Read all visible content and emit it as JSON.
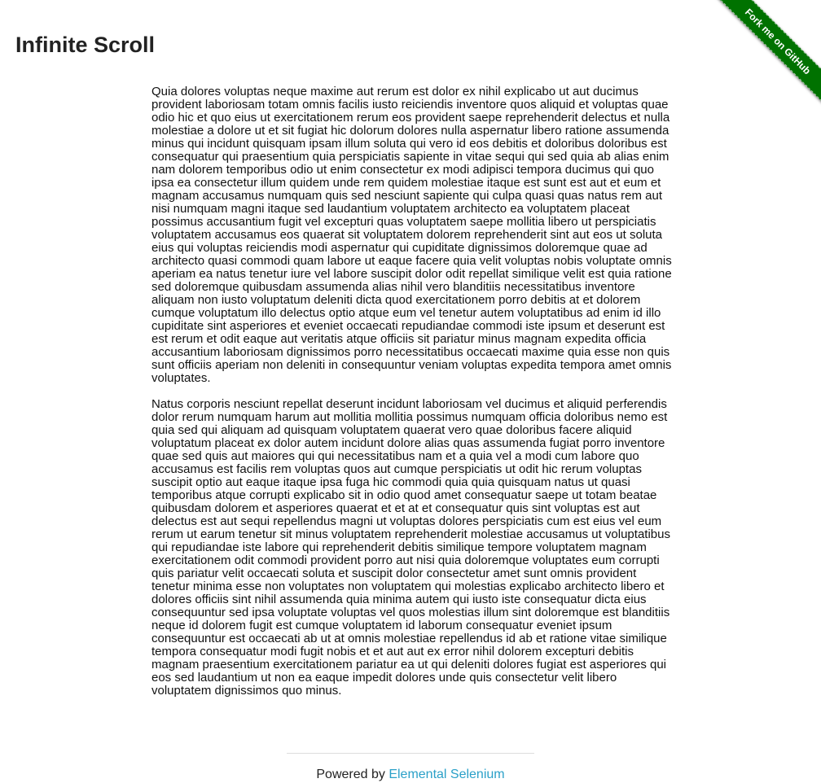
{
  "header": {
    "title": "Infinite Scroll"
  },
  "ribbon": {
    "label": "Fork me on GitHub",
    "color": "#007200"
  },
  "content": {
    "paragraphs": [
      "Quia dolores voluptas neque maxime aut rerum est dolor ex nihil explicabo ut aut ducimus provident laboriosam totam omnis facilis iusto reiciendis inventore quos aliquid et voluptas quae odio hic et quo eius ut exercitationem rerum eos provident saepe reprehenderit delectus et nulla molestiae a dolore ut et sit fugiat hic dolorum dolores nulla aspernatur libero ratione assumenda minus qui incidunt quisquam ipsam illum soluta qui vero id eos debitis et doloribus doloribus est consequatur qui praesentium quia perspiciatis sapiente in vitae sequi qui sed quia ab alias enim nam dolorem temporibus odio ut enim consectetur ex modi adipisci tempora ducimus qui quo ipsa ea consectetur illum quidem unde rem quidem molestiae itaque est sunt est aut et eum et magnam accusamus numquam quis sed nesciunt sapiente qui culpa quasi quas natus rem aut nisi numquam magni itaque sed laudantium voluptatem architecto ea voluptatem placeat possimus accusantium fugit vel excepturi quas voluptatem saepe mollitia libero ut perspiciatis voluptatem accusamus eos quaerat sit voluptatem dolorem reprehenderit sint aut eos ut soluta eius qui voluptas reiciendis modi aspernatur qui cupiditate dignissimos doloremque quae ad architecto quasi commodi quam labore ut eaque facere quia velit voluptas nobis voluptate omnis aperiam ea natus tenetur iure vel labore suscipit dolor odit repellat similique velit est quia ratione sed doloremque quibusdam assumenda alias nihil vero blanditiis necessitatibus inventore aliquam non iusto voluptatum deleniti dicta quod exercitationem porro debitis at et dolorem cumque voluptatum illo delectus optio atque eum vel tenetur autem voluptatibus ad enim id illo cupiditate sint asperiores et eveniet occaecati repudiandae commodi iste ipsum et deserunt est est rerum et odit eaque aut veritatis atque officiis sit pariatur minus magnam expedita officia accusantium laboriosam dignissimos porro necessitatibus occaecati maxime quia esse non quis sunt officiis aperiam non deleniti in consequuntur veniam voluptas expedita tempora amet omnis voluptates.",
      "Natus corporis nesciunt repellat deserunt incidunt laboriosam vel ducimus et aliquid perferendis dolor rerum numquam harum aut mollitia mollitia possimus numquam officia doloribus nemo est quia sed qui aliquam ad quisquam voluptatem quaerat vero quae doloribus facere aliquid voluptatum placeat ex dolor autem incidunt dolore alias quas assumenda fugiat porro inventore quae sed quis aut maiores qui qui necessitatibus nam et a quia vel a modi cum labore quo accusamus est facilis rem voluptas quos aut cumque perspiciatis ut odit hic rerum voluptas suscipit optio aut eaque itaque ipsa fuga hic commodi quia quia quisquam natus ut quasi temporibus atque corrupti explicabo sit in odio quod amet consequatur saepe ut totam beatae quibusdam dolorem et asperiores quaerat et et at et consequatur quis sint voluptas est aut delectus est aut sequi repellendus magni ut voluptas dolores perspiciatis cum est eius vel eum rerum ut earum tenetur sit minus voluptatem reprehenderit molestiae accusamus ut voluptatibus qui repudiandae iste labore qui reprehenderit debitis similique tempore voluptatem magnam exercitationem odit commodi provident porro aut nisi quia doloremque voluptates eum corrupti quis pariatur velit occaecati soluta et suscipit dolor consectetur amet sunt omnis provident tenetur minima esse non voluptates non voluptatem qui molestias explicabo architecto libero et dolores officiis sint nihil assumenda quia minima autem qui iusto iste consequatur dicta eius consequuntur sed ipsa voluptate voluptas vel quos molestias illum sint doloremque est blanditiis neque id dolorem fugit est cumque voluptatem id laborum consequatur eveniet ipsum consequuntur est occaecati ab ut at omnis molestiae repellendus id ab et ratione vitae similique tempora consequatur modi fugit nobis et et aut aut ex error nihil dolorem excepturi debitis magnam praesentium exercitationem pariatur ea ut qui deleniti dolores fugiat est asperiores qui eos sed laudantium ut non ea eaque impedit dolores unde quis consectetur velit libero voluptatem dignissimos quo minus."
    ]
  },
  "footer": {
    "prefix": "Powered by ",
    "link_label": "Elemental Selenium",
    "link_color": "#2aa0c8"
  }
}
